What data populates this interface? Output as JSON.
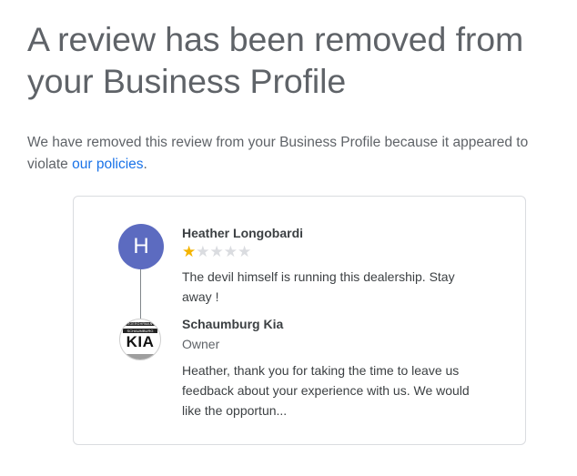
{
  "headline": "A review has been removed from your Business Profile",
  "notice": {
    "text_before": "We have removed this review from your Business Profile because it appeared to violate ",
    "link_label": "our policies",
    "text_after": "."
  },
  "review": {
    "avatar_initial": "H",
    "avatar_color": "#5c6bc0",
    "author": "Heather Longobardi",
    "rating": 1,
    "max_rating": 5,
    "text": "The devil himself is running this dealership. Stay away !"
  },
  "reply": {
    "owner_name": "Schaumburg Kia",
    "owner_role": "Owner",
    "logo_brand": "KIA",
    "logo_subtitle": "SCHAUMBURG",
    "logo_top": "JOEROHRMAN",
    "text": "Heather, thank you for taking the time to leave us feedback about your experience with us. We would like the opportun..."
  },
  "colors": {
    "star_filled": "#f4b400",
    "star_empty": "#dadce0",
    "link": "#1a73e8"
  }
}
